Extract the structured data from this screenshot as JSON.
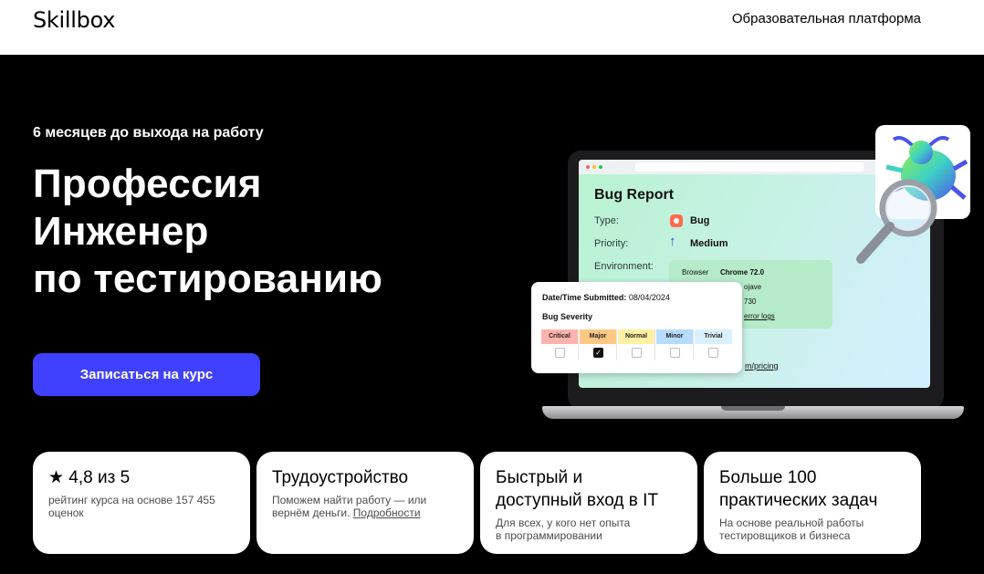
{
  "header": {
    "logo": "Skillbox",
    "platform_link": "Образовательная платформа"
  },
  "hero": {
    "kicker": "6 месяцев до выхода на работу",
    "title_lines": [
      "Профессия",
      "Инженер",
      "по тестированию"
    ],
    "cta_label": "Записаться на курс",
    "cta_color": "#4041ff"
  },
  "illustration": {
    "bug_report": {
      "title": "Bug Report",
      "type_label": "Type:",
      "type_value": "Bug",
      "priority_label": "Priority:",
      "priority_value": "Medium",
      "environment_label": "Environment:",
      "env_browser_label": "Browser",
      "env_browser_value": "Chrome 72.0",
      "env_os_fragment": "ojave",
      "env_build_fragment": "730",
      "env_logs_fragment": "error logs",
      "url_fragment": "m/pricing"
    },
    "popup": {
      "date_label": "Date/Time Submitted:",
      "date_value": "08/04/2024",
      "severity_title": "Bug Severity",
      "severity_levels": [
        {
          "label": "Critical",
          "color": "#ffb3ad",
          "checked": false
        },
        {
          "label": "Major",
          "color": "#ffc784",
          "checked": true
        },
        {
          "label": "Normal",
          "color": "#fff0a3",
          "checked": false
        },
        {
          "label": "Minor",
          "color": "#b5dcff",
          "checked": false
        },
        {
          "label": "Trivial",
          "color": "#d9f1ff",
          "checked": false
        }
      ]
    },
    "badge_icon": "bug-magnifier-icon"
  },
  "cards": [
    {
      "title": "★ 4,8 из 5",
      "text": "рейтинг курса на основе 157 455 оценок"
    },
    {
      "title": "Трудоустройство",
      "text_line1": "Поможем найти работу — или",
      "text_line2": "вернём деньги.",
      "link": "Подробности"
    },
    {
      "title_line1": "Быстрый и",
      "title_line2": "доступный вход в IT",
      "text_line1": "Для всех, у кого нет опыта",
      "text_line2": "в программировании"
    },
    {
      "title_line1": "Больше 100",
      "title_line2": "практических задач",
      "text_line1": "На основе реальной работы",
      "text_line2": "тестировщиков и бизнеса"
    }
  ]
}
